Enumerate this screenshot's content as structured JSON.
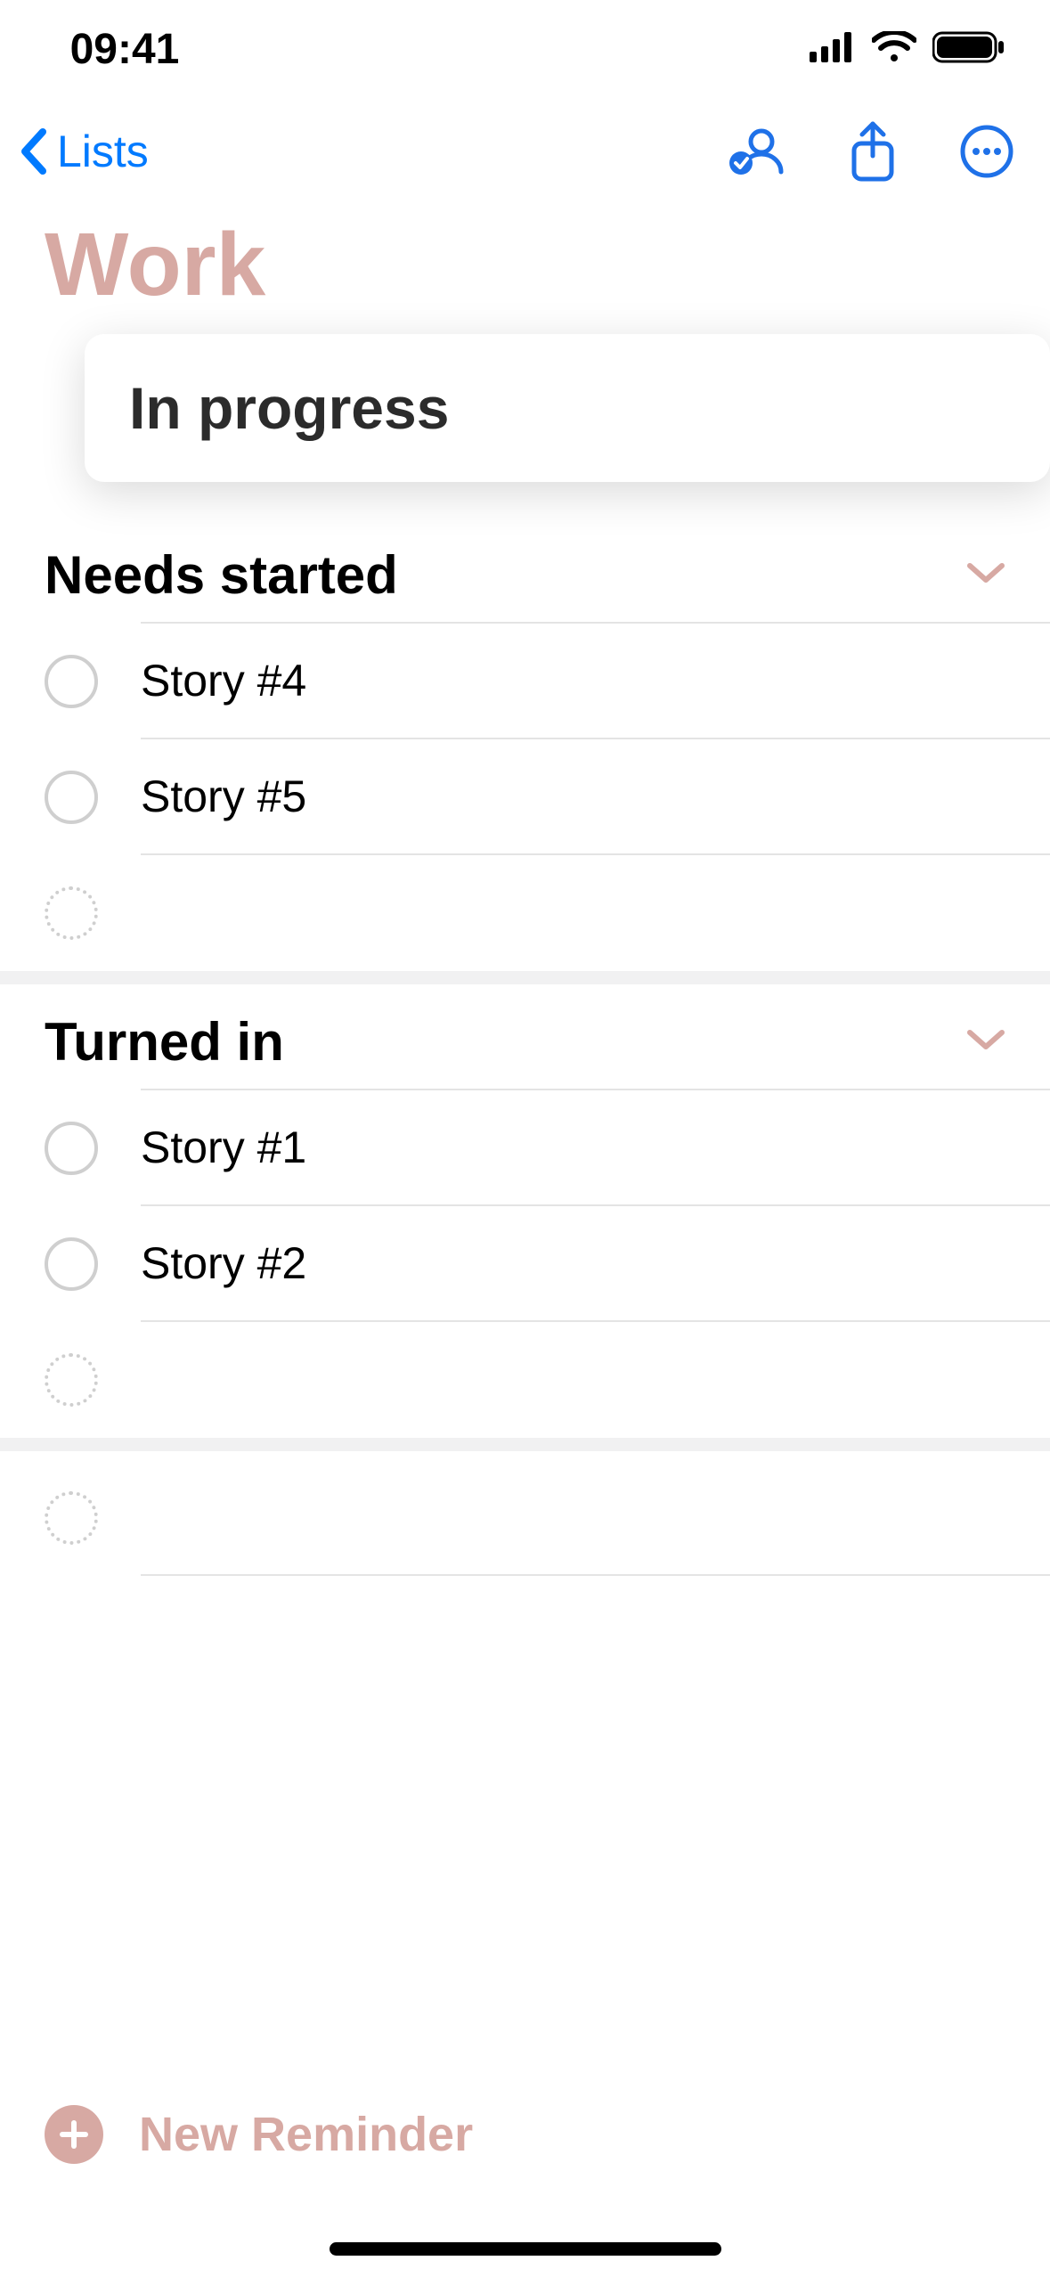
{
  "status": {
    "time": "09:41"
  },
  "nav": {
    "back_label": "Lists"
  },
  "list": {
    "title": "Work",
    "banner": "In progress"
  },
  "sections": [
    {
      "title": "Needs started",
      "items": [
        "Story #4",
        "Story #5"
      ]
    },
    {
      "title": "Turned in",
      "items": [
        "Story #1",
        "Story #2"
      ]
    }
  ],
  "footer": {
    "new_reminder": "New Reminder"
  }
}
